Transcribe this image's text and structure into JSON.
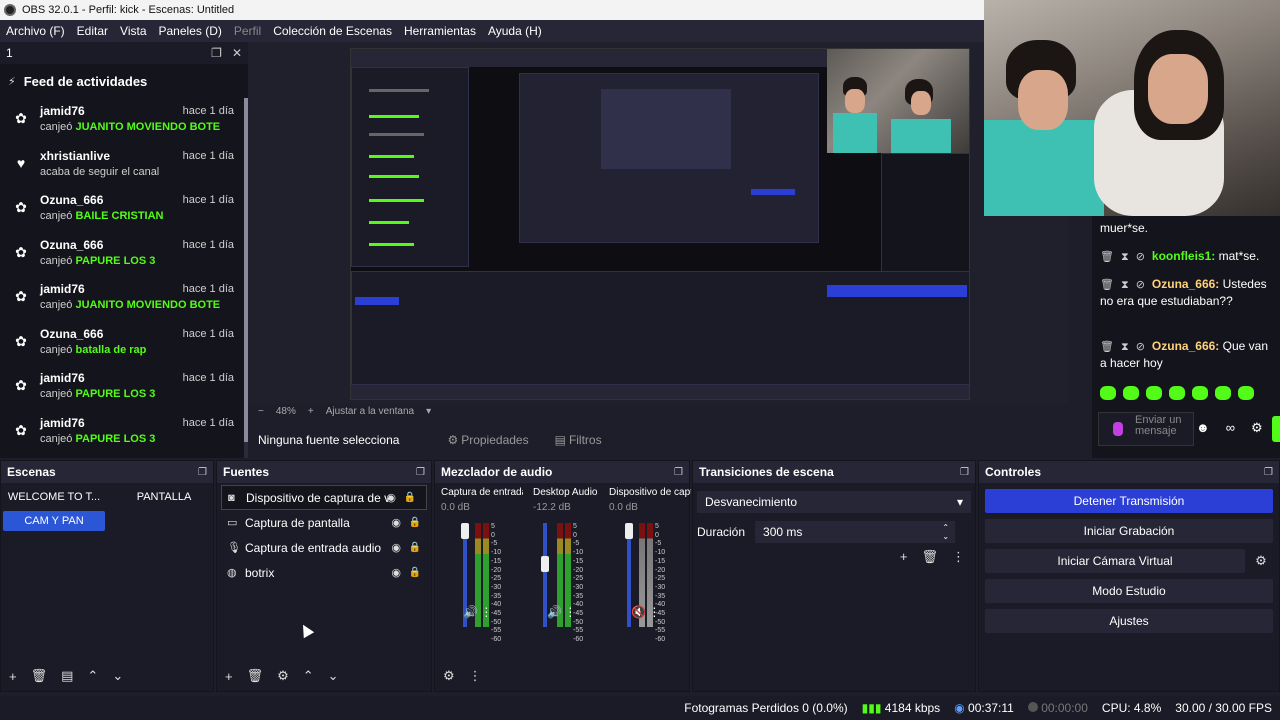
{
  "window": {
    "title": "OBS 32.0.1 - Perfil: kick - Escenas: Untitled"
  },
  "menu": [
    {
      "label": "Archivo (F)",
      "dim": false
    },
    {
      "label": "Editar",
      "dim": false
    },
    {
      "label": "Vista",
      "dim": false
    },
    {
      "label": "Paneles (D)",
      "dim": false
    },
    {
      "label": "Perfil",
      "dim": true
    },
    {
      "label": "Colección de Escenas",
      "dim": false
    },
    {
      "label": "Herramientas",
      "dim": false
    },
    {
      "label": "Ayuda (H)",
      "dim": false
    }
  ],
  "feed_dock": {
    "dock_title": "1",
    "title": "Feed de actividades",
    "items": [
      {
        "user": "jamid76",
        "time": "hace 1 día",
        "action": "canjeó",
        "highlight": "JUANITO MOVIENDO BOTE",
        "icon": "gift-icon"
      },
      {
        "user": "xhristianlive",
        "time": "hace 1 día",
        "action": "acaba de seguir el canal",
        "highlight": "",
        "icon": "heart-icon"
      },
      {
        "user": "Ozuna_666",
        "time": "hace 1 día",
        "action": "canjeó",
        "highlight": "BAILE CRISTIAN",
        "icon": "gift-icon"
      },
      {
        "user": "Ozuna_666",
        "time": "hace 1 día",
        "action": "canjeó",
        "highlight": "PAPURE LOS 3",
        "icon": "gift-icon"
      },
      {
        "user": "jamid76",
        "time": "hace 1 día",
        "action": "canjeó",
        "highlight": "JUANITO MOVIENDO BOTE",
        "icon": "gift-icon"
      },
      {
        "user": "Ozuna_666",
        "time": "hace 1 día",
        "action": "canjeó",
        "highlight": "batalla de rap",
        "icon": "gift-icon"
      },
      {
        "user": "jamid76",
        "time": "hace 1 día",
        "action": "canjeó",
        "highlight": "PAPURE LOS 3",
        "icon": "gift-icon"
      },
      {
        "user": "jamid76",
        "time": "hace 1 día",
        "action": "canjeó",
        "highlight": "PAPURE LOS 3",
        "icon": "gift-icon"
      }
    ]
  },
  "chat": {
    "messages": [
      {
        "user": "",
        "text": "muer*se."
      },
      {
        "user": "koonfleis1:",
        "text": "mat*se.",
        "green": true
      },
      {
        "user": "Ozuna_666:",
        "text": "Ustedes no era que estudiaban??"
      },
      {
        "user": "Ozuna_666:",
        "text": "Que van a hacer hoy"
      }
    ],
    "input_placeholder": "Enviar un mensaje"
  },
  "preview_bar": {
    "zoom": "48%",
    "fit": "Ajustar a la ventana"
  },
  "source_toolbar": {
    "no_source": "Ninguna fuente selecciona",
    "properties": "Propiedades",
    "filters": "Filtros"
  },
  "scenes": {
    "title": "Escenas",
    "items": [
      {
        "label": "WELCOME TO T...",
        "active": false
      },
      {
        "label": "PANTALLA",
        "active": false
      },
      {
        "label": "CAM Y PAN",
        "active": true
      }
    ]
  },
  "sources": {
    "title": "Fuentes",
    "items": [
      {
        "label": "Dispositivo de captura de v",
        "icon": "camera-icon",
        "selected": true
      },
      {
        "label": "Captura de pantalla",
        "icon": "monitor-icon",
        "selected": false
      },
      {
        "label": "Captura de entrada audio",
        "icon": "microphone-icon",
        "selected": false
      },
      {
        "label": "botrix",
        "icon": "globe-icon",
        "selected": false
      }
    ]
  },
  "mixer": {
    "title": "Mezclador de audio",
    "channels": [
      {
        "name": "Captura de entrada",
        "db": "0.0 dB",
        "level": 1.0,
        "muted": false
      },
      {
        "name": "Desktop Audio",
        "db": "-12.2 dB",
        "level": 0.62,
        "muted": false
      },
      {
        "name": "Dispositivo de capt",
        "db": "0.0 dB",
        "level": 1.0,
        "muted": true
      }
    ],
    "scale": [
      "5",
      "0",
      "-5",
      "-10",
      "-15",
      "-20",
      "-25",
      "-30",
      "-35",
      "-40",
      "-45",
      "-50",
      "-55",
      "-60"
    ]
  },
  "transitions": {
    "title": "Transiciones de escena",
    "selected": "Desvanecimiento",
    "duration_label": "Duración",
    "duration_value": "300 ms"
  },
  "controls": {
    "title": "Controles",
    "stop_stream": "Detener Transmisión",
    "start_recording": "Iniciar Grabación",
    "start_virtual_cam": "Iniciar Cámara Virtual",
    "studio_mode": "Modo Estudio",
    "settings": "Ajustes"
  },
  "status": {
    "dropped_frames": "Fotogramas Perdidos 0 (0.0%)",
    "bitrate": "4184 kbps",
    "stream_time": "00:37:11",
    "rec_time": "00:00:00",
    "cpu": "CPU: 4.8%",
    "fps": "30.00 / 30.00 FPS"
  },
  "colors": {
    "accent": "#2b3fd6",
    "kick_green": "#53fc18",
    "bg": "#1e1e2a"
  }
}
